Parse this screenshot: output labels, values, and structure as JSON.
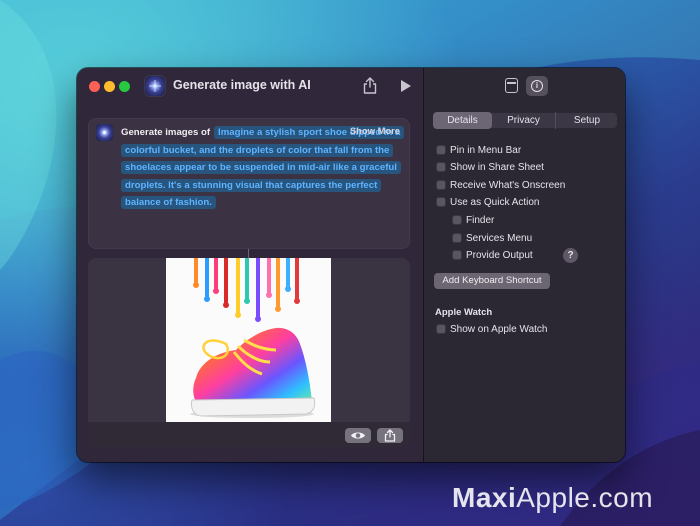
{
  "window": {
    "title": "Generate image with AI",
    "traffic_colors": {
      "close": "#fe5f57",
      "minimize": "#febc2e",
      "zoom": "#28c840"
    }
  },
  "action": {
    "label": "Generate images of",
    "prompt": "Imagine a stylish sport shoe dipped in a colorful bucket, and the droplets of color that fall from the shoelaces appear to be suspended in mid-air like a graceful droplets. It's a stunning visual that captures the perfect balance of fashion.",
    "show_more": "Show More"
  },
  "tabs": [
    {
      "label": "Details",
      "selected": true
    },
    {
      "label": "Privacy",
      "selected": false
    },
    {
      "label": "Setup",
      "selected": false
    }
  ],
  "options": {
    "pin_menu_bar": "Pin in Menu Bar",
    "share_sheet": "Show in Share Sheet",
    "onscreen": "Receive What's Onscreen",
    "quick_action": "Use as Quick Action",
    "finder": "Finder",
    "services_menu": "Services Menu",
    "provide_output": "Provide Output",
    "help": "?"
  },
  "keyboard_shortcut_button": "Add Keyboard Shortcut",
  "apple_watch": {
    "section_title": "Apple Watch",
    "show_on_watch": "Show on Apple Watch"
  },
  "watermark": {
    "part1": "Maxi",
    "part2": "Apple.com"
  },
  "colors": {
    "accent_token_bg": "#27557e",
    "accent_token_text": "#5fb3ff"
  }
}
